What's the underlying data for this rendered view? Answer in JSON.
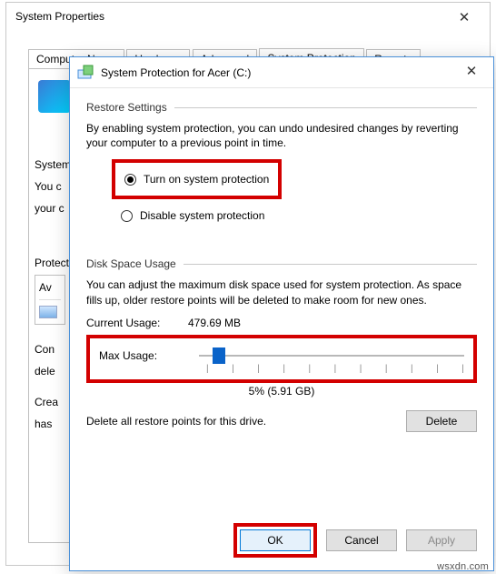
{
  "backwin": {
    "title": "System Properties",
    "tabs": [
      "Computer Name",
      "Hardware",
      "Advanced",
      "System Protection",
      "Remote"
    ],
    "selected_tab": "System Protection",
    "left_heading": "System",
    "para1a": "You c",
    "para1b": "your c",
    "protect_heading": "Protect",
    "avail": "Av",
    "conf_a": "Con",
    "conf_b": "dele",
    "crea_a": "Crea",
    "crea_b": "has"
  },
  "dialog": {
    "title": "System Protection for Acer (C:)",
    "restore": {
      "heading": "Restore Settings",
      "desc": "By enabling system protection, you can undo undesired changes by reverting your computer to a previous point in time.",
      "opt_on": "Turn on system protection",
      "opt_off": "Disable system protection",
      "selected": "on"
    },
    "disk": {
      "heading": "Disk Space Usage",
      "desc": "You can adjust the maximum disk space used for system protection. As space fills up, older restore points will be deleted to make room for new ones.",
      "current_label": "Current Usage:",
      "current_value": "479.69 MB",
      "max_label": "Max Usage:",
      "slider_percent": 5,
      "percent_text": "5% (5.91 GB)"
    },
    "delete_text": "Delete all restore points for this drive.",
    "btn_delete": "Delete",
    "btn_ok": "OK",
    "btn_cancel": "Cancel",
    "btn_apply": "Apply"
  },
  "watermark": "wsxdn.com"
}
